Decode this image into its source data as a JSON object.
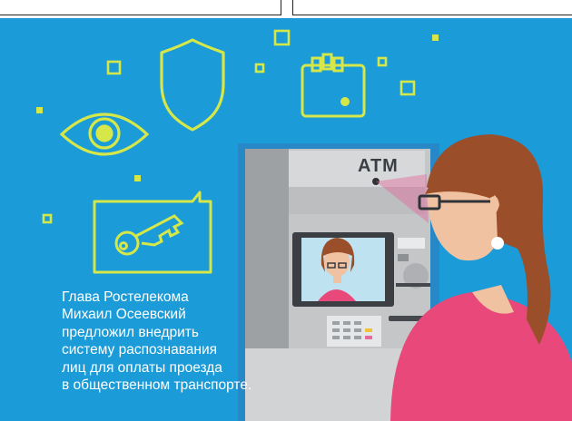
{
  "caption": {
    "lines": [
      "Глава Ростелекома",
      "Михаил Осеевский",
      "предложил внедрить",
      "систему распознавания",
      "лиц для оплаты проезда",
      "в общественном транспорте."
    ],
    "text": "Глава Ростелекома\nМихаил Осеевский\nпредложил внедрить\nсистему распознавания\nлиц для оплаты проезда\nв общественном транспорте."
  },
  "atm": {
    "label": "ATM"
  },
  "colors": {
    "background": "#1b9bd7",
    "icon_stroke": "#d6e74a",
    "scan_beam": "#e36a9b",
    "atm_body": "#c9cbcd",
    "hair": "#9a4e2a",
    "shirt": "#e8487a"
  },
  "icons": [
    "shield-icon",
    "eye-icon",
    "wallet-icon",
    "key-icon",
    "chat-bubble-icon"
  ]
}
